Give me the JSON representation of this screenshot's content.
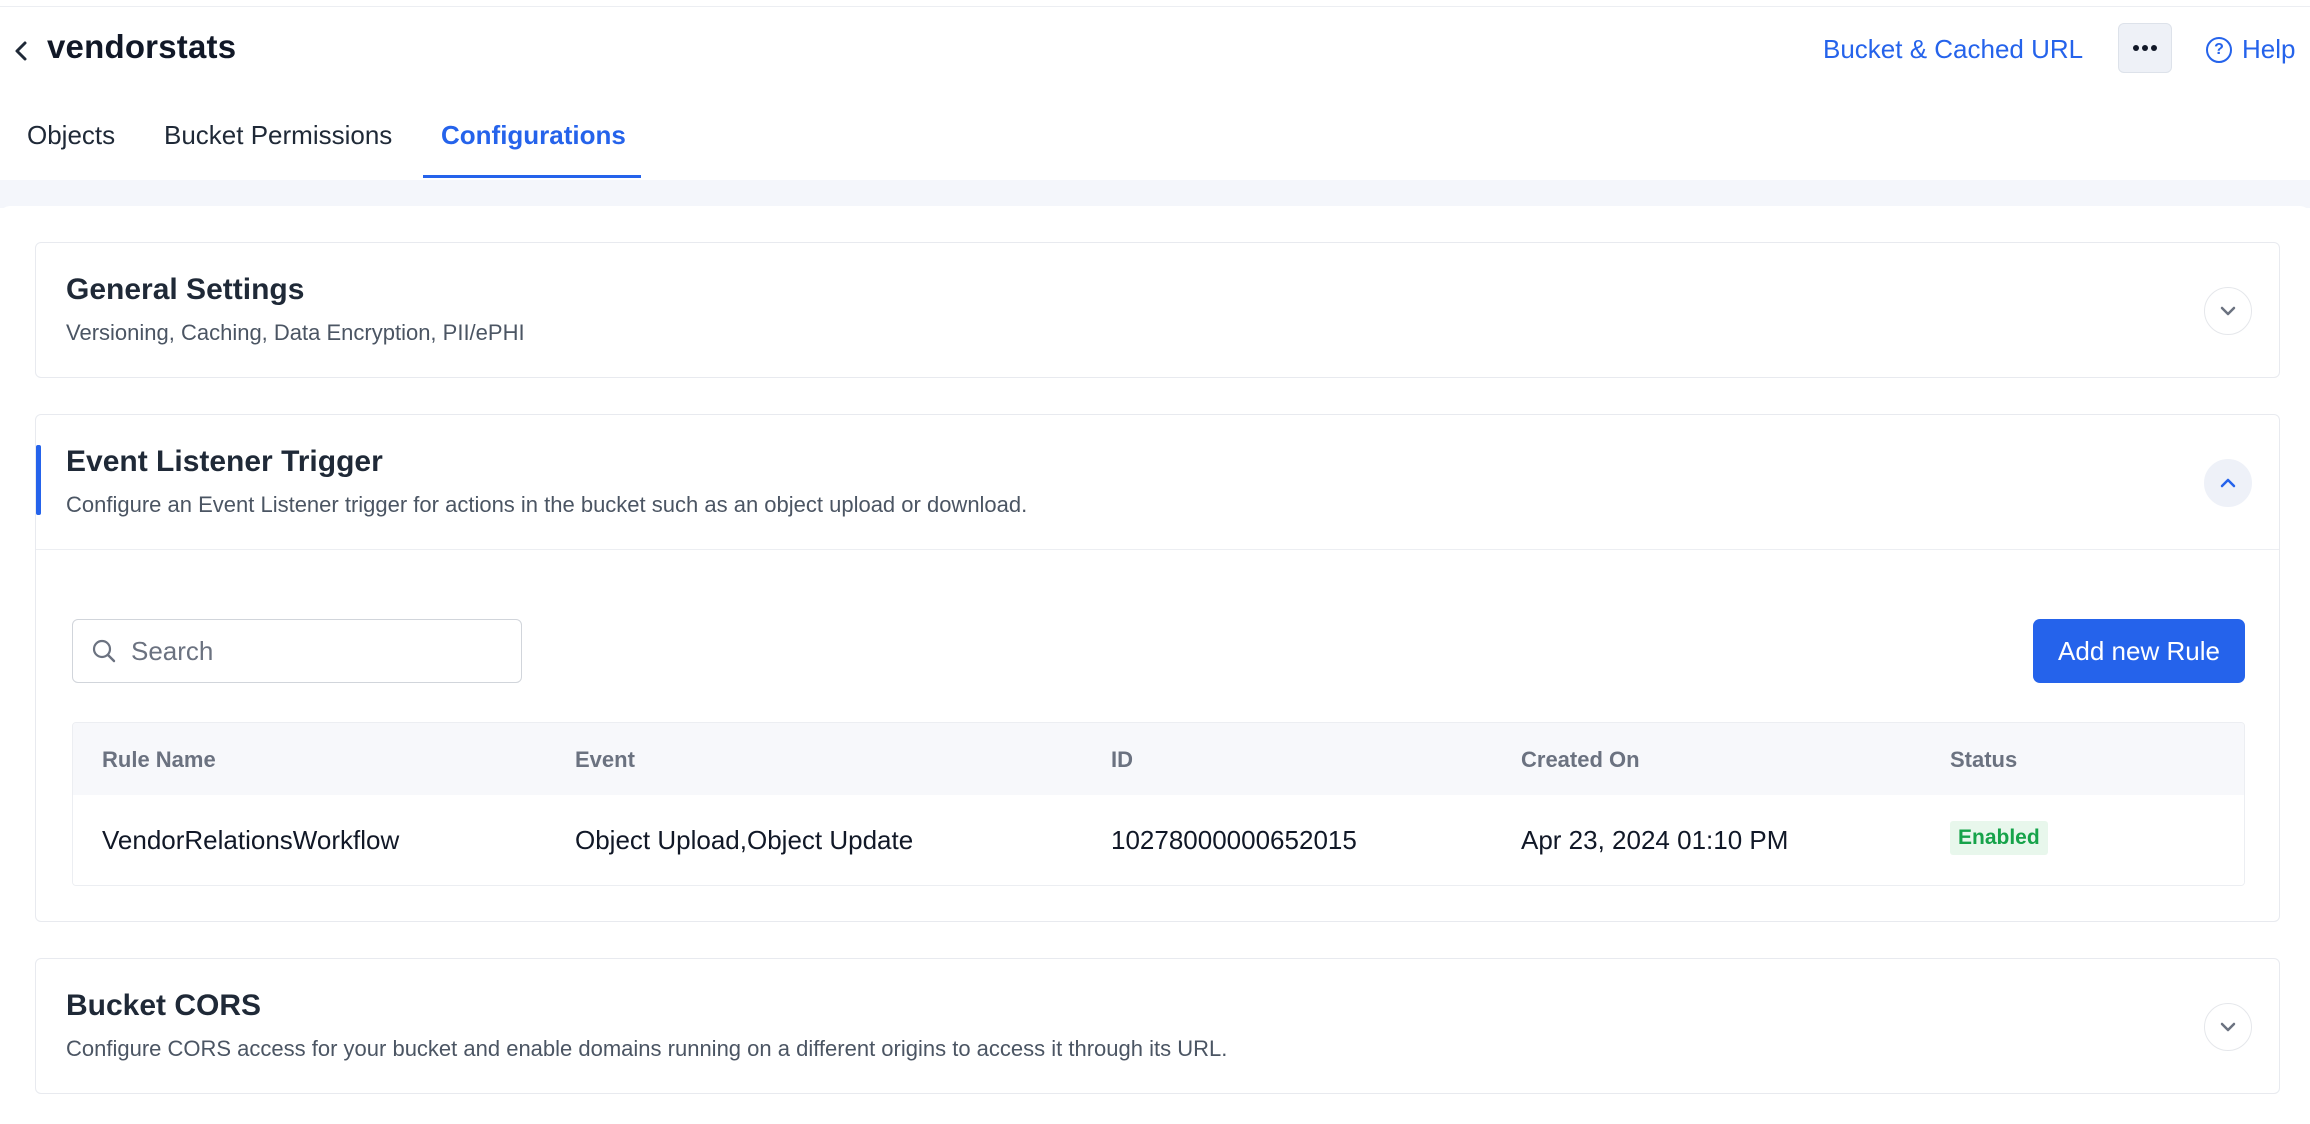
{
  "header": {
    "bucket_name": "vendorstats",
    "bucket_url_link": "Bucket & Cached URL",
    "help_label": "Help"
  },
  "tabs": [
    {
      "label": "Objects",
      "active": false
    },
    {
      "label": "Bucket Permissions",
      "active": false
    },
    {
      "label": "Configurations",
      "active": true
    }
  ],
  "sections": {
    "general": {
      "title": "General Settings",
      "subtitle": "Versioning, Caching, Data Encryption, PII/ePHI",
      "expanded": false
    },
    "event_listener": {
      "title": "Event Listener Trigger",
      "subtitle": "Configure an Event Listener trigger for actions in the bucket such as an object upload or download.",
      "expanded": true,
      "search_placeholder": "Search",
      "add_button": "Add new Rule",
      "table": {
        "columns": [
          "Rule Name",
          "Event",
          "ID",
          "Created On",
          "Status"
        ],
        "rows": [
          {
            "rule_name": "VendorRelationsWorkflow",
            "event": "Object Upload,Object Update",
            "id": "10278000000652015",
            "created_on": "Apr 23, 2024 01:10 PM",
            "status": "Enabled"
          }
        ]
      }
    },
    "cors": {
      "title": "Bucket CORS",
      "subtitle": "Configure CORS access for your bucket and enable domains running on a different origins to access it through its URL.",
      "expanded": false
    }
  },
  "colors": {
    "accent": "#2563eb",
    "status_enabled": "#16a34a",
    "status_enabled_bg": "#e8f7ec"
  },
  "icons": [
    "chevron-left-icon",
    "more-horizontal-icon",
    "help-circle-icon",
    "chevron-down-icon",
    "chevron-up-icon",
    "search-icon"
  ]
}
